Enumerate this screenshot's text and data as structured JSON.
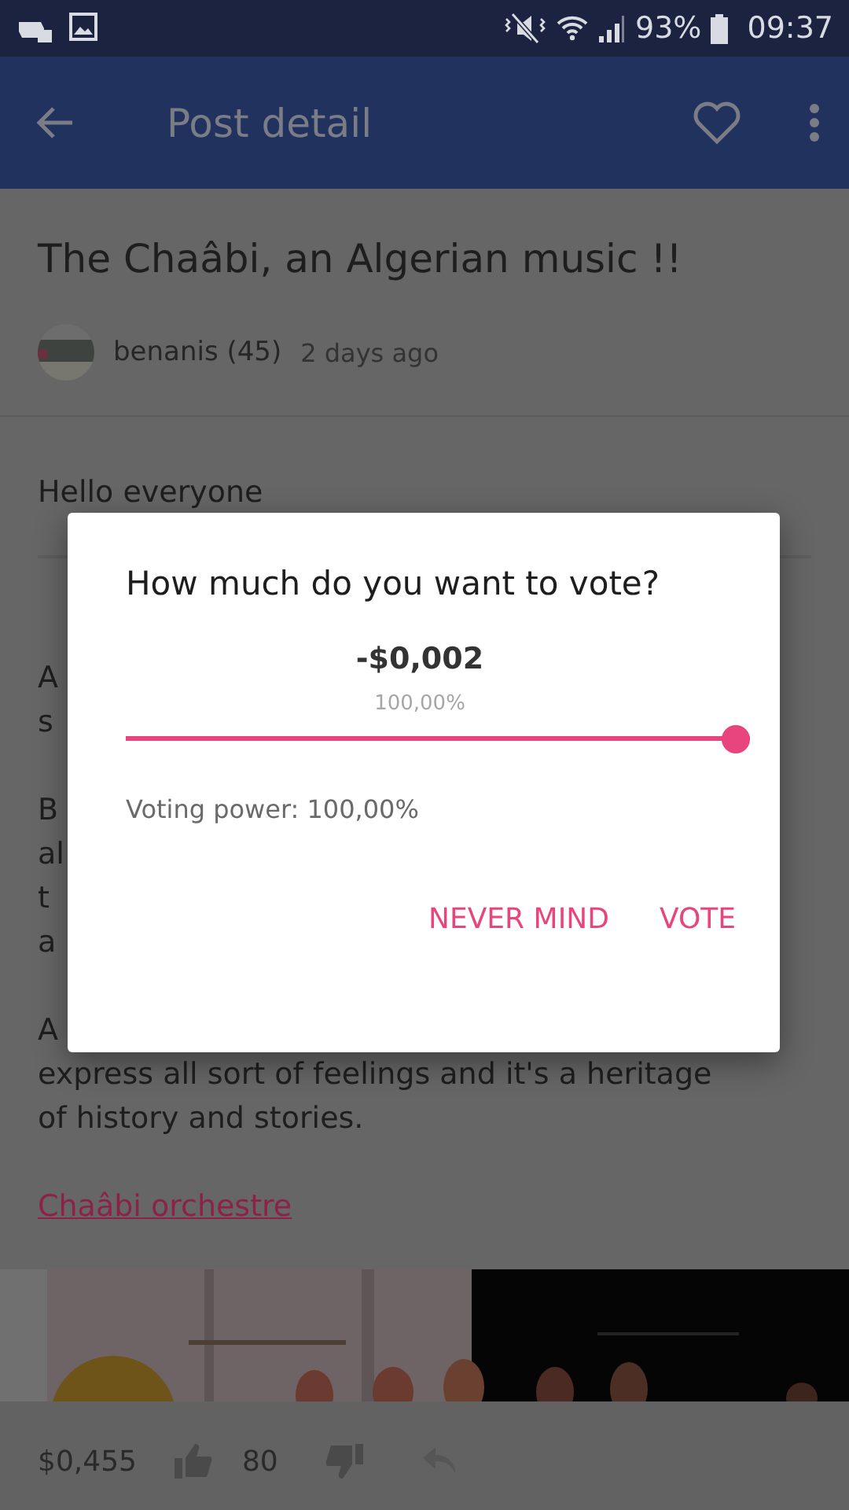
{
  "status_bar": {
    "battery": "93%",
    "time": "09:37"
  },
  "app_bar": {
    "title": "Post detail"
  },
  "post": {
    "title": "The Chaâbi, an Algerian music !!",
    "author": "benanis (45)",
    "age": "2 days ago",
    "intro": "Hello everyone",
    "paragraphs": [
      {
        "lines": [
          "A",
          "s"
        ]
      },
      {
        "lines": [
          "B",
          "al",
          "t",
          "a"
        ]
      },
      {
        "lines": [
          "A",
          "express all sort of feelings and it's a heritage",
          "of history and stories."
        ]
      }
    ],
    "link": "Chaâbi orchestre"
  },
  "footer": {
    "payout": "$0,455",
    "votes": "80"
  },
  "dialog": {
    "title": "How much do you want to vote?",
    "amount": "-$0,002",
    "percent": "100,00%",
    "level": 1,
    "power": "Voting power: 100,00%",
    "buttons": [
      "NEVER MIND",
      "VOTE"
    ]
  }
}
